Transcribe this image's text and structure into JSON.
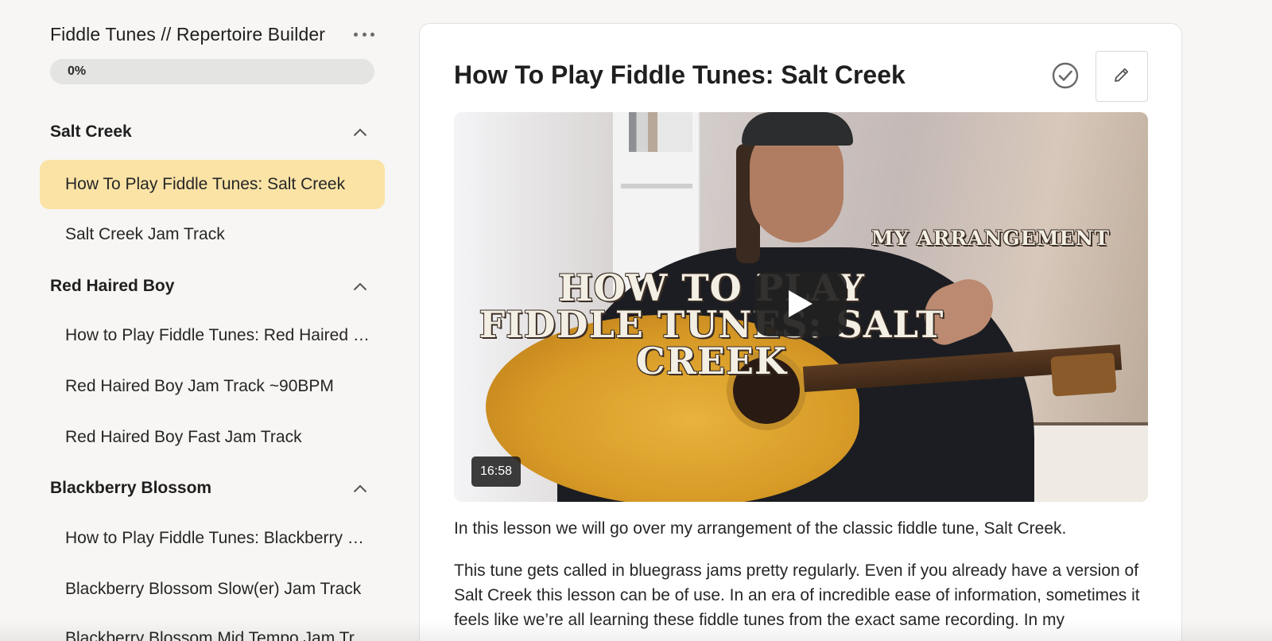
{
  "course": {
    "title": "Fiddle Tunes // Repertoire Builder",
    "progress_label": "0%",
    "progress_fraction": 0.0
  },
  "sidebar": {
    "sections": [
      {
        "title": "Salt Creek",
        "lessons": [
          "How To Play Fiddle Tunes: Salt Creek",
          "Salt Creek Jam Track"
        ]
      },
      {
        "title": "Red Haired Boy",
        "lessons": [
          "How to Play Fiddle Tunes: Red Haired Boy",
          "Red Haired Boy Jam Track ~90BPM",
          "Red Haired Boy Fast Jam Track"
        ]
      },
      {
        "title": "Blackberry Blossom",
        "lessons": [
          "How to Play Fiddle Tunes: Blackberry Bl...",
          "Blackberry Blossom Slow(er) Jam Track",
          "Blackberry Blossom Mid Tempo Jam Tr..."
        ]
      }
    ],
    "active_lesson": "How To Play Fiddle Tunes: Salt Creek"
  },
  "lesson": {
    "title": "How To Play Fiddle Tunes: Salt Creek",
    "video": {
      "thumbnail_subtitle": "MY ARRANGEMENT",
      "thumbnail_title_line1": "HOW TO PLAY",
      "thumbnail_title_line2": "FIDDLE TUNES: SALT",
      "thumbnail_title_line3": "CREEK",
      "duration": "16:58"
    },
    "paragraphs": [
      "In this lesson we will go over my arrangement of the classic fiddle tune, Salt Creek.",
      "This tune gets called in bluegrass jams pretty regularly. Even if you already have a version of Salt Creek this lesson can be of use. In an era of incredible ease of information, sometimes it feels like we’re all learning these fiddle tunes from the exact same recording. In my"
    ]
  },
  "colors": {
    "active_item_bg": "#fbe3a6",
    "progress_track": "#e4e4e2",
    "page_bg": "#f7f6f4"
  }
}
